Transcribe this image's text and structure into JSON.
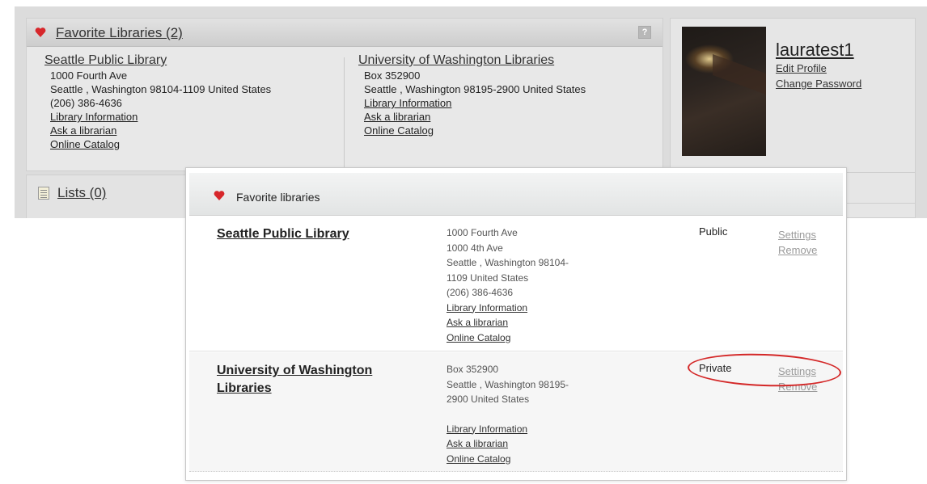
{
  "background": {
    "favorites": {
      "title": "Favorite Libraries (2)",
      "help": "?",
      "libraries": [
        {
          "name": "Seattle Public Library",
          "lines": [
            "1000 Fourth Ave",
            "Seattle , Washington 98104-1109 United States",
            "(206) 386-4636"
          ],
          "links": [
            "Library Information",
            "Ask a librarian",
            "Online Catalog"
          ]
        },
        {
          "name": "University of Washington Libraries",
          "lines": [
            "Box 352900",
            "Seattle , Washington 98195-2900 United States"
          ],
          "links": [
            "Library Information",
            "Ask a librarian",
            "Online Catalog"
          ]
        }
      ]
    },
    "lists": {
      "title": "Lists (0)"
    },
    "profile": {
      "username": "lauratest1",
      "edit_profile": "Edit Profile",
      "change_password": "Change Password"
    }
  },
  "card": {
    "title": "Favorite libraries",
    "rows": [
      {
        "name": "Seattle Public Library",
        "address": [
          "1000 Fourth Ave",
          "1000 4th Ave",
          "Seattle ,  Washington 98104-",
          "1109 United States",
          "(206) 386-4636"
        ],
        "links": [
          "Library Information",
          "Ask a librarian",
          "Online Catalog"
        ],
        "privacy": "Public",
        "settings": "Settings",
        "remove": "Remove"
      },
      {
        "name": "University of Washington Libraries",
        "address": [
          "Box 352900",
          "Seattle ,  Washington 98195-",
          "2900 United States"
        ],
        "links": [
          "Library Information",
          "Ask a librarian",
          "Online Catalog"
        ],
        "privacy": "Private",
        "settings": "Settings",
        "remove": "Remove"
      }
    ]
  },
  "colors": {
    "heart": "#d7272b",
    "highlight": "#d42828",
    "action_link": "#9a9a9a"
  },
  "icons": [
    "heart-icon",
    "help-icon",
    "list-icon"
  ]
}
